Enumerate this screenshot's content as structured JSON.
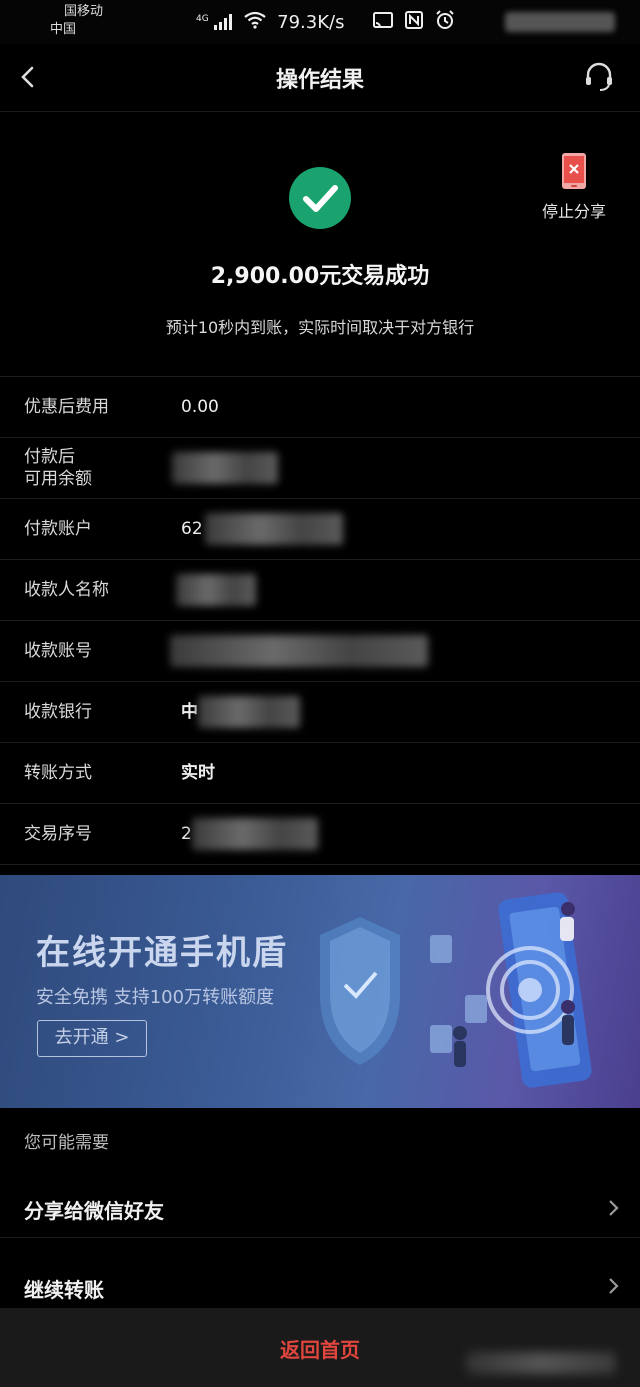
{
  "status_bar": {
    "carrier_line1": "国移动",
    "carrier_line2": "中国",
    "signal": "4G",
    "speed": "79.3K/s"
  },
  "nav": {
    "title": "操作结果"
  },
  "result": {
    "amount_text": "2,900.00元交易成功",
    "hint": "预计10秒内到账，实际时间取决于对方银行",
    "stop_share_label": "停止分享",
    "accent_color": "#1aa36f"
  },
  "details": [
    {
      "label": "优惠后费用",
      "value": "0.00"
    },
    {
      "label_line1": "付款后",
      "label_line2": "可用余额",
      "value": ""
    },
    {
      "label": "付款账户",
      "value": "62"
    },
    {
      "label": "收款人名称",
      "value": ""
    },
    {
      "label": "收款账号",
      "value": ""
    },
    {
      "label": "收款银行",
      "value": "中"
    },
    {
      "label": "转账方式",
      "value": "实时"
    },
    {
      "label": "交易序号",
      "value": "2"
    }
  ],
  "banner": {
    "title": "在线开通手机盾",
    "subtitle": "安全免携 支持100万转账额度",
    "button_label": "去开通 >"
  },
  "suggestions": {
    "heading": "您可能需要",
    "items": [
      {
        "label": "分享给微信好友"
      },
      {
        "label": "继续转账"
      }
    ]
  },
  "footer": {
    "home_label": "返回首页",
    "accent_color": "#e0463e"
  }
}
